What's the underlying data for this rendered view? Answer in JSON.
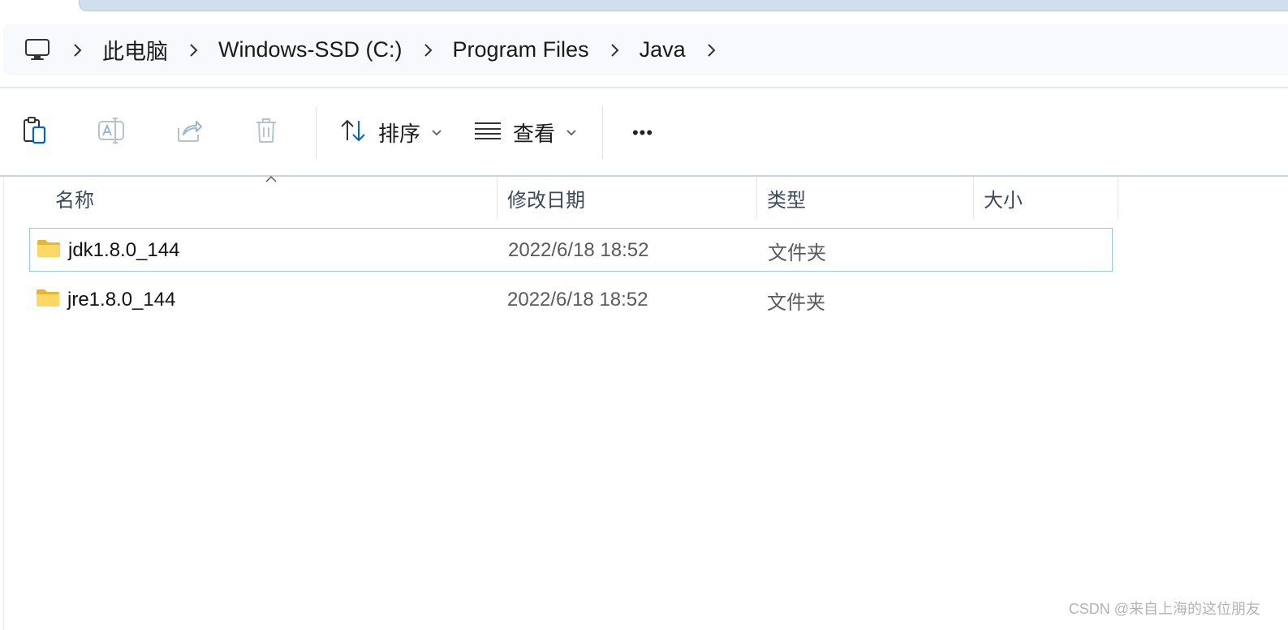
{
  "breadcrumb": {
    "items": [
      "此电脑",
      "Windows-SSD (C:)",
      "Program Files",
      "Java"
    ]
  },
  "commandbar": {
    "sort_label": "排序",
    "view_label": "查看",
    "more_label": "•••"
  },
  "columns": {
    "name": "名称",
    "modified": "修改日期",
    "type": "类型",
    "size": "大小"
  },
  "files": [
    {
      "name": "jdk1.8.0_144",
      "modified": "2022/6/18 18:52",
      "type": "文件夹",
      "size": ""
    },
    {
      "name": "jre1.8.0_144",
      "modified": "2022/6/18 18:52",
      "type": "文件夹",
      "size": ""
    }
  ],
  "watermark": "CSDN @来自上海的这位朋友",
  "colors": {
    "accent": "#0067c0",
    "selection_border": "#99c9ea",
    "folder": "#f4c542"
  }
}
